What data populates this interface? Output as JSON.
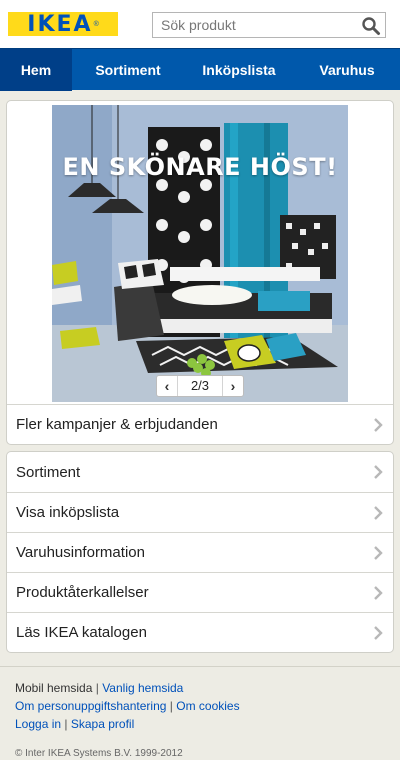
{
  "header": {
    "logo": "IKEA",
    "logo_mark": "®",
    "search_placeholder": "Sök produkt"
  },
  "nav": {
    "items": [
      {
        "label": "Hem"
      },
      {
        "label": "Sortiment"
      },
      {
        "label": "Inköpslista"
      },
      {
        "label": "Varuhus"
      }
    ]
  },
  "banner": {
    "title": "EN SKÖNARE HÖST!",
    "pager": "2/3",
    "prev": "‹",
    "next": "›"
  },
  "campaign_link": "Fler kampanjer & erbjudanden",
  "menu": [
    {
      "label": "Sortiment"
    },
    {
      "label": "Visa inköpslista"
    },
    {
      "label": "Varuhusinformation"
    },
    {
      "label": "Produktåterkallelser"
    },
    {
      "label": "Läs IKEA katalogen"
    }
  ],
  "footer": {
    "mobile": "Mobil hemsida",
    "regular": "Vanlig hemsida",
    "privacy": "Om personuppgiftshantering",
    "cookies": "Om cookies",
    "login": "Logga in",
    "profile": "Skapa profil",
    "copyright": "© Inter IKEA Systems B.V. 1999-2012",
    "separator": "|"
  }
}
